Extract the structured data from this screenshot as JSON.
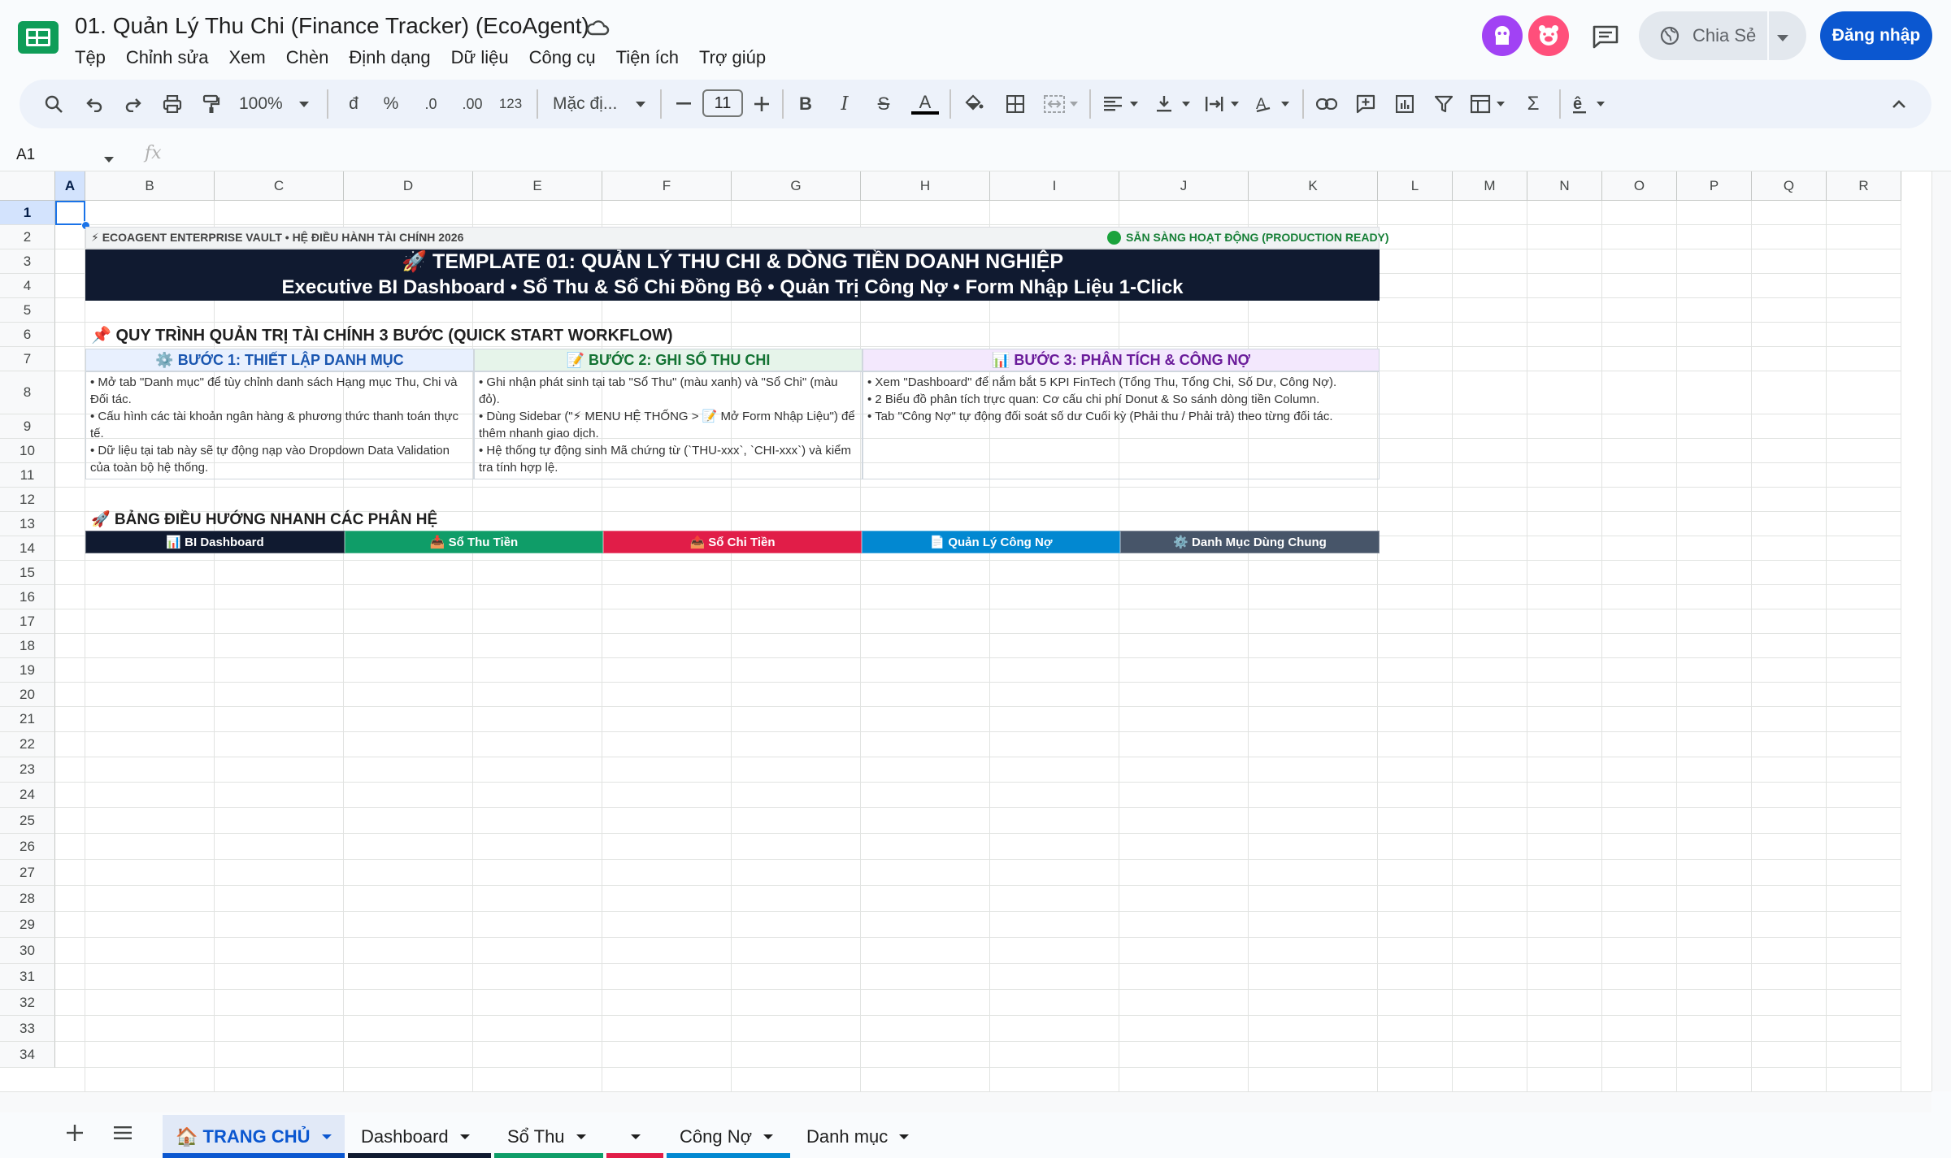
{
  "app": {
    "doc_title": "01. Quản Lý Thu Chi (Finance Tracker) (EcoAgent)",
    "menu": [
      "Tệp",
      "Chỉnh sửa",
      "Xem",
      "Chèn",
      "Định dạng",
      "Dữ liệu",
      "Công cụ",
      "Tiện ích",
      "Trợ giúp"
    ],
    "share_label": "Chia Sẻ",
    "login_label": "Đăng nhập"
  },
  "toolbar": {
    "zoom": "100%",
    "currency": "đ",
    "percent": "%",
    "dec_decrease": ".0",
    "dec_increase": ".00",
    "number_format": "123",
    "font_family": "Mặc đị...",
    "font_size": "11"
  },
  "formula_bar": {
    "cell_ref": "A1",
    "fx_label": "fx"
  },
  "grid": {
    "columns": [
      "A",
      "B",
      "C",
      "D",
      "E",
      "F",
      "G",
      "H",
      "I",
      "J",
      "K",
      "L",
      "M",
      "N",
      "O",
      "P",
      "Q",
      "R"
    ],
    "rows": [
      "1",
      "2",
      "3",
      "4",
      "5",
      "6",
      "7",
      "8",
      "9",
      "10",
      "11",
      "12",
      "13",
      "14",
      "15",
      "16",
      "17",
      "18",
      "19",
      "20",
      "21",
      "22",
      "23",
      "24",
      "25",
      "26",
      "27",
      "28",
      "29",
      "30",
      "31",
      "32",
      "33",
      "34"
    ]
  },
  "content": {
    "vault_label": "⚡ ECOAGENT ENTERPRISE VAULT • HỆ ĐIỀU HÀNH TÀI CHÍNH 2026",
    "ready_label": "SẴN SÀNG HOẠT ĐỘNG (PRODUCTION READY)",
    "banner_title": "🚀 TEMPLATE 01: QUẢN LÝ THU CHI & DÒNG TIỀN DOANH NGHIỆP",
    "banner_sub": "Executive BI Dashboard • Sổ Thu & Sổ Chi Đồng Bộ • Quản Trị Công Nợ • Form Nhập Liệu 1-Click",
    "workflow_title": "📌 QUY TRÌNH QUẢN TRỊ TÀI CHÍNH 3 BƯỚC (QUICK START WORKFLOW)",
    "steps": [
      {
        "title": "⚙️ BƯỚC 1: THIẾT LẬP DANH MỤC",
        "color": "#1a56b0",
        "bg": "#e8f0fe",
        "lines": [
          "• Mở tab \"Danh mục\" để tùy chỉnh danh sách Hạng mục Thu, Chi và Đối tác.",
          "• Cấu hình các tài khoản ngân hàng & phương thức thanh toán thực tế.",
          "• Dữ liệu tại tab này sẽ tự động nạp vào Dropdown Data Validation của toàn bộ hệ thống."
        ]
      },
      {
        "title": "📝 BƯỚC 2: GHI SỔ THU CHI",
        "color": "#137333",
        "bg": "#e6f4ea",
        "lines": [
          "• Ghi nhận phát sinh tại tab \"Sổ Thu\" (màu xanh) và \"Sổ Chi\" (màu đỏ).",
          "• Dùng Sidebar (\"⚡ MENU HỆ THỐNG > 📝 Mở Form Nhập Liệu\") để thêm nhanh giao dịch.",
          "• Hệ thống tự động sinh Mã chứng từ (`THU-xxx`, `CHI-xxx`) và kiểm tra tính hợp lệ."
        ]
      },
      {
        "title": "📊 BƯỚC 3: PHÂN TÍCH & CÔNG NỢ",
        "color": "#6a1b9a",
        "bg": "#f3e8fd",
        "lines": [
          "• Xem \"Dashboard\" để nắm bắt 5 KPI FinTech (Tổng Thu, Tổng Chi, Số Dư, Công Nợ).",
          "• 2 Biểu đồ phân tích trực quan: Cơ cấu chi phí Donut & So sánh dòng tiền Column.",
          "• Tab \"Công Nợ\" tự động đối soát số dư Cuối kỳ (Phải thu / Phải trả) theo từng đối tác."
        ]
      }
    ],
    "nav_title": "🚀 BẢNG ĐIỀU HƯỚNG NHANH CÁC PHÂN HỆ",
    "nav_buttons": [
      {
        "label": "📊 BI Dashboard",
        "color": "#101a30"
      },
      {
        "label": "📥 Sổ Thu Tiền",
        "color": "#0f9d68"
      },
      {
        "label": "📤 Sổ Chi Tiền",
        "color": "#e11d48"
      },
      {
        "label": "📄 Quản Lý Công Nợ",
        "color": "#0288d1"
      },
      {
        "label": "⚙️ Danh Mục Dùng Chung",
        "color": "#475569"
      }
    ]
  },
  "tabs": [
    {
      "label": "🏠 TRANG CHỦ",
      "active": true,
      "color": "#0b57d0"
    },
    {
      "label": "Dashboard",
      "active": false,
      "color": "#101a30"
    },
    {
      "label": "Sổ Thu",
      "active": false,
      "color": "#0f9d68"
    },
    {
      "label": "",
      "active": false,
      "color": "#e11d48"
    },
    {
      "label": "Công Nợ",
      "active": false,
      "color": "#0288d1"
    },
    {
      "label": "Danh mục",
      "active": false,
      "color": ""
    }
  ]
}
